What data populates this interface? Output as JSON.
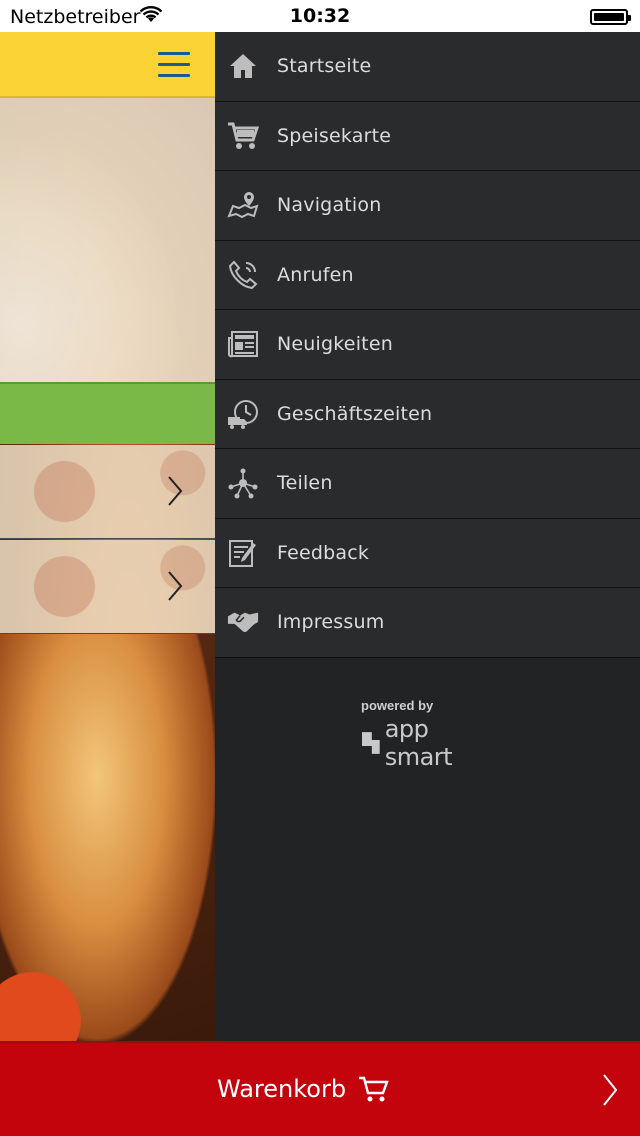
{
  "status_bar": {
    "carrier": "Netzbetreiber",
    "time": "10:32"
  },
  "menu": {
    "items": [
      {
        "label": "Startseite",
        "icon": "home-icon"
      },
      {
        "label": "Speisekarte",
        "icon": "cart-icon"
      },
      {
        "label": "Navigation",
        "icon": "map-pin-icon"
      },
      {
        "label": "Anrufen",
        "icon": "phone-icon"
      },
      {
        "label": "Neuigkeiten",
        "icon": "newspaper-icon"
      },
      {
        "label": "Geschäftszeiten",
        "icon": "clock-truck-icon"
      },
      {
        "label": "Teilen",
        "icon": "share-icon"
      },
      {
        "label": "Feedback",
        "icon": "feedback-icon"
      },
      {
        "label": "Impressum",
        "icon": "handshake-icon"
      }
    ],
    "powered_by": "powered by",
    "brand": "app smart"
  },
  "cart": {
    "label": "Warenkorb"
  },
  "colors": {
    "header": "#fcd335",
    "menu_bg": "#2a2b2d",
    "cart_bar": "#c4040d",
    "green": "#7ab948"
  }
}
